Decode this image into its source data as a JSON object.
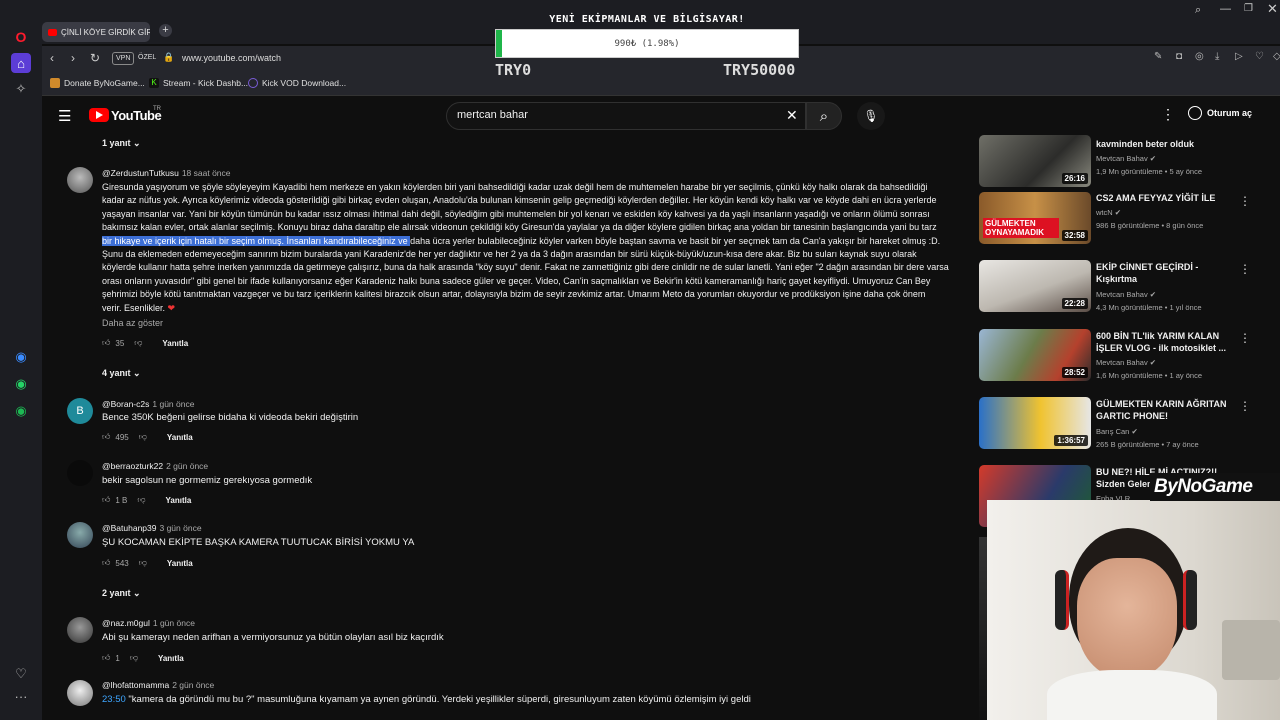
{
  "window": {
    "title_overlay": "YENİ EKİPMANLAR VE BİLGİSAYAR!"
  },
  "progress": {
    "text": "990₺ (1.98%)",
    "fraction": 0.0198,
    "min_label": "TRY0",
    "max_label": "TRY50000",
    "fill_color": "#1fb54a"
  },
  "tab": {
    "label": "ÇİNLİ KÖYE GİRDİK GİRME"
  },
  "address": {
    "url": "www.youtube.com/watch",
    "vpn": "VPN",
    "private": "ÖZEL"
  },
  "bookmarks": [
    {
      "label": "Donate ByNoGame...",
      "icon": "bynogame-icon",
      "color": "#d08a2b"
    },
    {
      "label": "Stream - Kick Dashb...",
      "icon": "kick-icon",
      "color": "#53fc18"
    },
    {
      "label": "Kick VOD Download...",
      "icon": "globe-icon",
      "color": "#7a5cd6"
    }
  ],
  "youtube": {
    "logo": "YouTube",
    "region": "TR",
    "search_value": "mertcan bahar",
    "signin": "Oturum aç"
  },
  "comments": {
    "top_replies": "1 yanıt",
    "c1": {
      "author": "@ZerdustunTutkusu",
      "time": "18 saat önce",
      "lines": [
        "Giresunda yaşıyorum ve şöyle söyleyeyim Kayadibi hem merkeze en yakın köylerden biri yani bahsedildiği kadar uzak değil hem de muhtemelen harabe bir yer seçilmis, çünkü köy halkı olarak da bahsedildiği",
        "kadar az nüfus yok. Ayrıca köylerimiz videoda gösterildiği gibi birkaç evden oluşan, Anadolu'da bulunan kimsenin gelip geçmediği köylerden değiller. Her köyün kendi köy halkı var ve köyde dahi en ücra yerlerde",
        "yaşayan insanlar var. Yani bir köyün tümünün bu kadar ıssız olması ihtimal dahi değil, söylediğim gibi muhtemelen bir yol kenarı ve eskiden köy kahvesi ya da yaşlı insanların yaşadığı ve onların ölümü sonrası",
        "bakımsız kalan evler, ortak alanlar seçilmiş. Konuyu biraz daha daraltıp ele alırsak videonun çekildiği köy Giresun'da yaylalar ya da diğer köylere gidilen birkaç ana yoldan bir tanesinin başlangıcında yani bu tarz"
      ],
      "line5_highlight": "bir hikaye ve içerik için hatalı bir seçim olmuş. İnsanları kandırabileceğiniz ve ",
      "line5_rest": "daha ücra yerler bulabileceğiniz köyler varken böyle baştan savma ve basit bir yer seçmek tam da Can'a yakışır bir hareket olmuş :D.",
      "lines_after": [
        "Şunu da eklemeden edemeyeceğim sanırım bizim buralarda yani Karadeniz'de her yer dağlıktır ve her 2 ya da 3 dağın arasından bir sürü küçük-büyük/uzun-kısa dere akar. Biz bu suları kaynak suyu olarak",
        "köylerde kullanır hatta şehre inerken yanımızda da getirmeye çalışırız, buna da halk arasında \"köy suyu\" denir. Fakat ne zannettiğiniz gibi dere cinlidir ne de sular lanetli. Yani eğer \"2 dağın arasından bir dere varsa",
        "orası onların yuvasıdır\" gibi genel bir ifade kullanıyorsanız eğer Karadeniz halkı buna sadece güler ve geçer. Video, Can'in saçmalıkları ve Bekir'in kötü kameramanlığı hariç gayet keyifliydi. Umuyoruz Can Bey",
        "şehrimizi böyle kötü tanıtmaktan vazgeçer ve bu tarz içeriklerin kalitesi birazcık olsun artar, dolayısıyla bizim de seyir zevkimiz artar. Umarım Meto da yorumları okuyordur ve prodüksiyon işine daha çok önem",
        "verir. Esenlikler."
      ],
      "show_less": "Daha az göster",
      "likes": "35",
      "reply": "Yanıtla",
      "replies": "4 yanıt"
    },
    "c2": {
      "author": "@Boran-c2s",
      "time": "1 gün önce",
      "text": "Bence 350K beğeni gelirse bidaha ki videoda bekiri değiştirin",
      "likes": "495",
      "reply": "Yanıtla",
      "avatar_letter": "B"
    },
    "c3": {
      "author": "@berraozturk22",
      "time": "2 gün önce",
      "text": "bekir sagolsun ne gormemiz gerekıyosa gormedık",
      "likes": "1 B",
      "reply": "Yanıtla"
    },
    "c4": {
      "author": "@Batuhanp39",
      "time": "3 gün önce",
      "text": "ŞU KOCAMAN EKİPTE BAŞKA KAMERA TUUTUCAK BİRİSİ YOKMU YA",
      "likes": "543",
      "reply": "Yanıtla",
      "replies": "2 yanıt"
    },
    "c5": {
      "author": "@naz.m0gul",
      "time": "1 gün önce",
      "text": "Abi şu kamerayı neden arifhan a vermiyorsunuz ya bütün olayları asıl biz kaçırdık",
      "likes": "1",
      "reply": "Yanıtla"
    },
    "c6": {
      "author": "@lhofattomamma",
      "time": "2 gün önce",
      "timestamp": "23:50",
      "text": " \"kamera da göründü mu bu ?\" masumluğuna kıyamam ya aynen göründü. Yerdeki yeşillikler süperdi, giresunluyum zaten köyümü özlemişim iyi geldi"
    }
  },
  "recommendations": [
    {
      "title": "kavminden beter olduk",
      "channel": "Mevtcan Bahav",
      "views": "1,9 Mn görüntüleme • 5 ay önce",
      "duration": "26:16"
    },
    {
      "title": "CS2 AMA FEYYAZ YİĞİT İLE",
      "channel": "wtcN",
      "views": "986 B görüntüleme • 8 gün önce",
      "duration": "32:58",
      "thumb_text": "GÜLMEKTEN OYNAYAMADIK"
    },
    {
      "title": "EKİP CİNNET GEÇİRDİ - Kışkırtma",
      "channel": "Mevtcan Bahav",
      "views": "4,3 Mn görüntüleme • 1 yıl önce",
      "duration": "22:28"
    },
    {
      "title": "600 BİN TL'lik YARIM KALAN İŞLER VLOG - ilk motosiklet ...",
      "channel": "Mevtcan Bahav",
      "views": "1,6 Mn görüntüleme • 1 ay önce",
      "duration": "28:52"
    },
    {
      "title": "GÜLMEKTEN KARIN AĞRITAN GARTIC PHONE!",
      "channel": "Barış Can",
      "views": "265 B görüntüleme • 7 ay önce",
      "duration": "1:36:57"
    },
    {
      "title": "BU NE?! HİLE Mİ ACTINIZ?!! Sizden Gelen",
      "channel": "Enba VLR",
      "views": "",
      "duration": ""
    }
  ],
  "overlay_logo": "ByNoGame"
}
